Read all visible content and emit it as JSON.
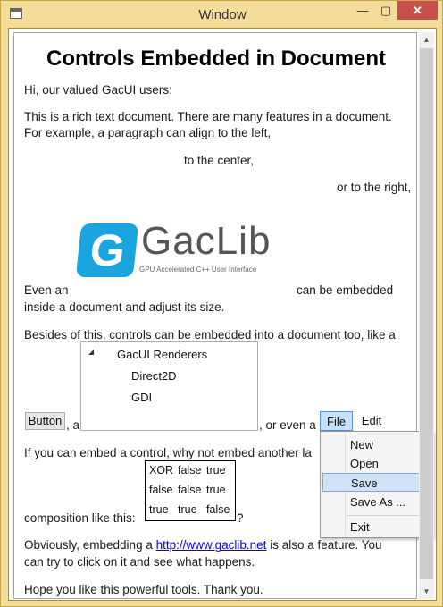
{
  "window": {
    "title": "Window",
    "minimize_glyph": "—",
    "maximize_glyph": "▢",
    "close_glyph": "✕"
  },
  "doc": {
    "heading": "Controls Embedded in Document",
    "greeting": "Hi, our valued GacUI users:",
    "para1_line1": "This is a rich text document. There are many features in a document.",
    "para1_line2": "For example, a paragraph can align to the left,",
    "center_line": "to the center,",
    "right_line": "or to the right,",
    "logo": {
      "letter": "G",
      "name": "GacLib",
      "tagline": "GPU Accelerated C++ User Interface"
    },
    "image_line1_a": "Even an",
    "image_line1_b": "can be embedded",
    "image_line2": "inside a document and adjust its size.",
    "controls_line": "Besides of this, controls can be embedded into a document too, like a",
    "tree": {
      "root": "GacUI Renderers",
      "children": [
        "Direct2D",
        "GDI"
      ]
    },
    "button_label": "Button",
    "comma_a": ", a",
    "or_even_a": ", or even a",
    "menu": {
      "file": "File",
      "edit": "Edit",
      "items": [
        "New",
        "Open",
        "Save",
        "Save As ...",
        "Exit"
      ],
      "selected": "Save"
    },
    "embed_line": "If you can embed a control, why not embed another la",
    "table": [
      [
        "XOR",
        "false",
        "true"
      ],
      [
        "false",
        "false",
        "true"
      ],
      [
        "true",
        "true",
        "false"
      ]
    ],
    "composition_line": "composition like this:",
    "question_mark": "?",
    "link_line_a": "Obviously, embedding a",
    "link_text": "http://www.gaclib.net",
    "link_line_b": "is also a feature. You",
    "link_line2": "can try to click on it and see what happens.",
    "closing": "Hope you like this powerful tools. Thank you."
  },
  "scroll": {
    "up": "▲",
    "down": "▼"
  }
}
